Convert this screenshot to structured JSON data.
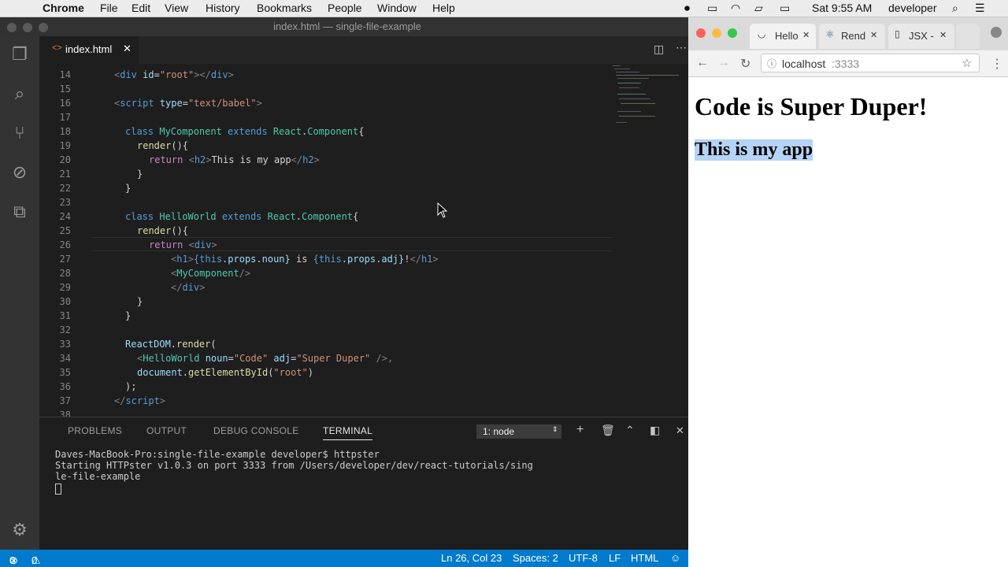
{
  "menubar": {
    "app": "Chrome",
    "items": [
      "File",
      "Edit",
      "View",
      "History",
      "Bookmarks",
      "People",
      "Window",
      "Help"
    ],
    "clock": "Sat 9:55 AM",
    "user": "developer"
  },
  "vscode": {
    "window_title": "index.html — single-file-example",
    "tab_label": "index.html",
    "panel_tabs": [
      "PROBLEMS",
      "OUTPUT",
      "DEBUG CONSOLE",
      "TERMINAL"
    ],
    "terminal_select": "1: node",
    "line_numbers": [
      "14",
      "15",
      "16",
      "17",
      "18",
      "19",
      "20",
      "21",
      "22",
      "23",
      "24",
      "25",
      "26",
      "27",
      "28",
      "29",
      "30",
      "31",
      "32",
      "33",
      "34",
      "35",
      "36",
      "37",
      "38"
    ],
    "terminal_lines": [
      "Daves-MacBook-Pro:single-file-example developer$ httpster",
      "Starting HTTPster v1.0.3 on port 3333 from /Users/developer/dev/react-tutorials/sing",
      "le-file-example"
    ],
    "status": {
      "errors": "0",
      "warnings": "0",
      "position": "Ln 26, Col 23",
      "spaces": "Spaces: 2",
      "encoding": "UTF-8",
      "eol": "LF",
      "language": "HTML"
    }
  },
  "browser": {
    "tabs": [
      "Hello",
      "Rend",
      "JSX -"
    ],
    "url_host": "localhost",
    "url_port": ":3333",
    "page_heading": "Code is Super Duper!",
    "page_subheading": "This is my app"
  },
  "code": {
    "l14": [
      "<",
      "div",
      " id",
      "=",
      "\"root\"",
      ">",
      "</",
      "div",
      ">"
    ],
    "l16": [
      "<",
      "script",
      " type",
      "=",
      "\"text/babel\"",
      ">"
    ],
    "l18": [
      "class",
      " MyComponent",
      " extends",
      " React",
      ".",
      "Component",
      "{"
    ],
    "l19": [
      "render",
      "(){"
    ],
    "l20": [
      "return",
      " ",
      "<",
      "h2",
      ">",
      "This is my app",
      "</",
      "h2",
      ">"
    ],
    "l21": "}",
    "l22": "}",
    "l24": [
      "class",
      " HelloWorld",
      " extends",
      " React",
      ".",
      "Component",
      "{"
    ],
    "l25": [
      "render",
      "(){"
    ],
    "l26": [
      "return",
      " ",
      "<",
      "div",
      ">"
    ],
    "l27": [
      "<",
      "h1",
      ">",
      "{this",
      ".props.noun}",
      " is ",
      "{this",
      ".props.adj}",
      "!",
      "</",
      "h1",
      ">"
    ],
    "l28": [
      "<",
      "MyComponent",
      "/>"
    ],
    "l29": [
      "</",
      "div",
      ">"
    ],
    "l30": "}",
    "l31": "}",
    "l33": [
      "ReactDOM",
      ".",
      "render",
      "("
    ],
    "l34": [
      "<",
      "HelloWorld",
      " noun",
      "=",
      "\"Code\"",
      " adj",
      "=",
      "\"Super Duper\"",
      " />,"
    ],
    "l35": [
      "document",
      ".",
      "getElementById",
      "(",
      "\"root\"",
      ")"
    ],
    "l36": ");",
    "l37": [
      "</",
      "script",
      ">"
    ]
  }
}
